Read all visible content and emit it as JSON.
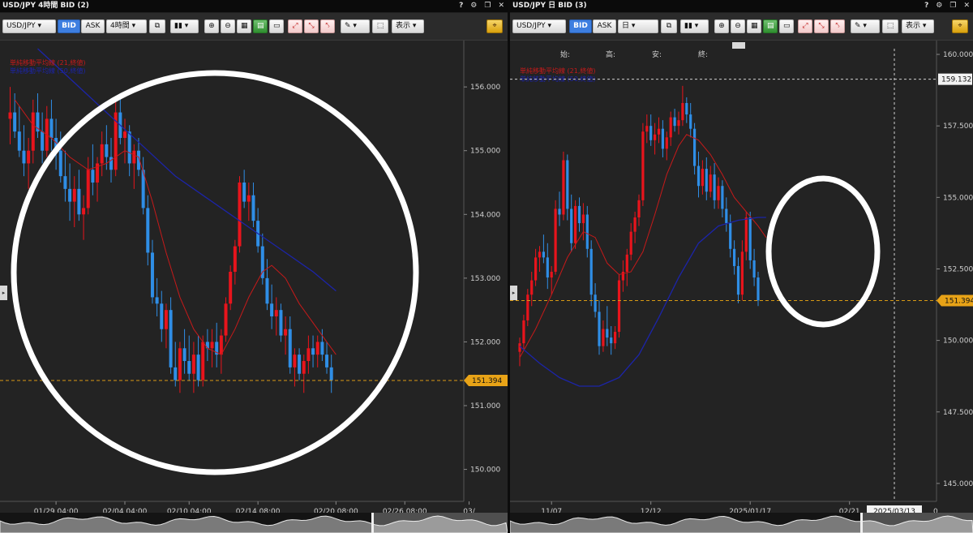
{
  "colors": {
    "up": "#e8141c",
    "down": "#2f8ee6",
    "sma21": "#c61a1a",
    "sma50": "#1c24a8",
    "price_line": "#d89a14",
    "price_label_bg": "#e8a317",
    "grid": "#3a3a3a",
    "axis_text": "#cfcfcf"
  },
  "icons": {
    "help": "question-icon",
    "settings": "gear-icon",
    "restore": "window-restore-icon",
    "close": "close-icon"
  },
  "left": {
    "title": "USD/JPY 4時間 BID (2)",
    "symbol": "USD/JPY",
    "bid_label": "BID",
    "ask_label": "ASK",
    "timeframe": "4時間",
    "display_label": "表示",
    "current_price_label": "151.394",
    "legend": [
      "単純移動平均線 (21,終値)",
      "単純移動平均線 (50,終値)"
    ]
  },
  "right": {
    "title": "USD/JPY 日 BID (3)",
    "symbol": "USD/JPY",
    "bid_label": "BID",
    "ask_label": "ASK",
    "timeframe": "日",
    "display_label": "表示",
    "ohlc_labels": [
      "始:",
      "高:",
      "安:",
      "終:"
    ],
    "current_price_label": "151.394",
    "crosshair_price_label": "159.132",
    "crosshair_date_label": "2025/03/13",
    "nav_zero": "0",
    "legend": [
      "単純移動平均線 (21,終値)",
      "単純移動平均線 (50,終値)"
    ]
  },
  "chart_data": [
    {
      "type": "candlestick",
      "pair": "USD/JPY",
      "timeframe": "4H",
      "ylim": [
        149.6,
        156.6
      ],
      "yticks": [
        150.0,
        151.0,
        152.0,
        153.0,
        154.0,
        155.0,
        156.0
      ],
      "ytick_labels": [
        "150.000",
        "151.000",
        "152.000",
        "153.000",
        "154.000",
        "155.000",
        "156.000"
      ],
      "xticks": [
        {
          "label": "01/29 04:00",
          "index": 10
        },
        {
          "label": "02/04 04:00",
          "index": 25
        },
        {
          "label": "02/10 04:00",
          "index": 39
        },
        {
          "label": "02/14 08:00",
          "index": 54
        },
        {
          "label": "02/20 08:00",
          "index": 71
        },
        {
          "label": "02/26 08:00",
          "index": 86
        },
        {
          "label": "03/",
          "index": 100
        }
      ],
      "current_price": 151.394,
      "ohlc": [
        [
          155.5,
          156.0,
          155.1,
          155.6
        ],
        [
          155.6,
          155.9,
          155.2,
          155.3
        ],
        [
          155.3,
          155.7,
          154.9,
          155.0
        ],
        [
          155.0,
          155.4,
          154.6,
          154.8
        ],
        [
          154.8,
          155.2,
          154.4,
          155.0
        ],
        [
          155.0,
          155.8,
          154.8,
          155.6
        ],
        [
          155.6,
          155.9,
          155.2,
          155.3
        ],
        [
          155.3,
          155.6,
          154.8,
          155.0
        ],
        [
          155.0,
          155.7,
          154.9,
          155.5
        ],
        [
          155.5,
          155.8,
          155.0,
          155.2
        ],
        [
          155.2,
          155.5,
          154.7,
          155.0
        ],
        [
          155.0,
          155.3,
          154.5,
          154.6
        ],
        [
          154.6,
          155.0,
          154.2,
          154.4
        ],
        [
          154.4,
          154.8,
          153.9,
          154.2
        ],
        [
          154.2,
          154.6,
          153.8,
          154.4
        ],
        [
          154.4,
          154.7,
          153.9,
          154.0
        ],
        [
          154.0,
          154.3,
          153.6,
          154.1
        ],
        [
          154.1,
          154.9,
          154.0,
          154.7
        ],
        [
          154.7,
          155.1,
          154.3,
          154.5
        ],
        [
          154.5,
          154.9,
          154.2,
          154.8
        ],
        [
          154.8,
          155.3,
          154.6,
          155.1
        ],
        [
          155.1,
          155.4,
          154.7,
          154.9
        ],
        [
          154.9,
          155.2,
          154.5,
          154.7
        ],
        [
          154.7,
          155.8,
          154.6,
          155.6
        ],
        [
          155.6,
          155.9,
          155.1,
          155.2
        ],
        [
          155.2,
          155.5,
          154.8,
          155.3
        ],
        [
          155.3,
          155.4,
          154.6,
          154.8
        ],
        [
          154.8,
          155.1,
          154.4,
          155.0
        ],
        [
          155.0,
          155.2,
          154.6,
          154.7
        ],
        [
          154.7,
          154.9,
          154.0,
          154.1
        ],
        [
          154.1,
          154.3,
          153.2,
          153.4
        ],
        [
          153.4,
          153.6,
          152.6,
          152.7
        ],
        [
          152.7,
          153.0,
          152.4,
          152.6
        ],
        [
          152.6,
          152.8,
          152.0,
          152.2
        ],
        [
          152.2,
          152.6,
          151.9,
          152.5
        ],
        [
          152.5,
          152.7,
          151.5,
          151.6
        ],
        [
          151.6,
          152.0,
          151.3,
          151.4
        ],
        [
          151.4,
          152.0,
          151.2,
          151.9
        ],
        [
          151.9,
          152.2,
          151.5,
          151.7
        ],
        [
          151.7,
          152.1,
          151.4,
          151.5
        ],
        [
          151.5,
          152.0,
          151.2,
          151.8
        ],
        [
          151.8,
          152.1,
          151.3,
          151.4
        ],
        [
          151.4,
          152.1,
          151.3,
          152.0
        ],
        [
          152.0,
          152.2,
          151.7,
          151.9
        ],
        [
          151.9,
          152.2,
          151.6,
          152.0
        ],
        [
          152.0,
          152.3,
          151.6,
          151.8
        ],
        [
          151.8,
          152.2,
          151.5,
          152.1
        ],
        [
          152.1,
          152.7,
          152.0,
          152.6
        ],
        [
          152.6,
          153.2,
          152.5,
          153.1
        ],
        [
          153.1,
          153.6,
          152.9,
          153.5
        ],
        [
          153.5,
          154.6,
          153.4,
          154.5
        ],
        [
          154.5,
          154.7,
          154.1,
          154.2
        ],
        [
          154.2,
          154.5,
          153.9,
          154.3
        ],
        [
          154.3,
          154.5,
          153.8,
          153.9
        ],
        [
          153.9,
          154.1,
          153.4,
          153.5
        ],
        [
          153.5,
          153.7,
          152.9,
          153.0
        ],
        [
          153.0,
          153.3,
          152.5,
          152.6
        ],
        [
          152.6,
          152.9,
          152.2,
          152.4
        ],
        [
          152.4,
          152.7,
          152.1,
          152.5
        ],
        [
          152.5,
          152.6,
          152.0,
          152.1
        ],
        [
          152.1,
          152.4,
          151.8,
          152.2
        ],
        [
          152.2,
          152.4,
          151.5,
          151.6
        ],
        [
          151.6,
          151.9,
          151.3,
          151.8
        ],
        [
          151.8,
          151.9,
          151.4,
          151.5
        ],
        [
          151.5,
          151.8,
          151.2,
          151.7
        ],
        [
          151.7,
          152.1,
          151.5,
          151.9
        ],
        [
          151.9,
          152.1,
          151.6,
          151.8
        ],
        [
          151.8,
          152.1,
          151.6,
          152.0
        ],
        [
          152.0,
          152.2,
          151.7,
          151.8
        ],
        [
          151.8,
          152.0,
          151.5,
          151.6
        ],
        [
          151.6,
          151.8,
          151.2,
          151.4
        ]
      ],
      "sma21": [
        [
          1,
          155.8
        ],
        [
          5,
          155.4
        ],
        [
          9,
          155.2
        ],
        [
          13,
          154.9
        ],
        [
          17,
          154.7
        ],
        [
          21,
          154.8
        ],
        [
          25,
          155.0
        ],
        [
          28,
          154.9
        ],
        [
          31,
          154.2
        ],
        [
          34,
          153.4
        ],
        [
          37,
          152.7
        ],
        [
          40,
          152.2
        ],
        [
          43,
          151.9
        ],
        [
          46,
          151.8
        ],
        [
          49,
          152.2
        ],
        [
          52,
          152.7
        ],
        [
          55,
          153.1
        ],
        [
          57,
          153.2
        ],
        [
          60,
          153.0
        ],
        [
          63,
          152.6
        ],
        [
          66,
          152.3
        ],
        [
          69,
          152.0
        ],
        [
          71,
          151.8
        ]
      ],
      "sma50": [
        [
          6,
          156.6
        ],
        [
          12,
          156.2
        ],
        [
          18,
          155.8
        ],
        [
          24,
          155.4
        ],
        [
          30,
          155.0
        ],
        [
          36,
          154.6
        ],
        [
          42,
          154.3
        ],
        [
          48,
          154.0
        ],
        [
          54,
          153.7
        ],
        [
          60,
          153.4
        ],
        [
          66,
          153.1
        ],
        [
          71,
          152.8
        ]
      ]
    },
    {
      "type": "candlestick",
      "pair": "USD/JPY",
      "timeframe": "D",
      "ylim": [
        144.6,
        160.2
      ],
      "yticks": [
        145.0,
        147.5,
        150.0,
        152.5,
        155.0,
        157.5,
        160.0
      ],
      "ytick_labels": [
        "145.000",
        "147.500",
        "150.000",
        "152.500",
        "155.000",
        "157.500",
        "160.000"
      ],
      "xticks": [
        {
          "label": "11/07",
          "index": 8
        },
        {
          "label": "12/12",
          "index": 33
        },
        {
          "label": "2025/01/17",
          "index": 58
        },
        {
          "label": "02/21",
          "index": 83
        }
      ],
      "current_price": 151.394,
      "crosshair_price": 159.132,
      "crosshair_date": "2025/03/13",
      "ohlc": [
        [
          149.6,
          150.1,
          149.1,
          149.9
        ],
        [
          149.9,
          150.9,
          149.7,
          150.7
        ],
        [
          150.7,
          151.8,
          150.5,
          151.6
        ],
        [
          151.6,
          152.4,
          151.2,
          152.1
        ],
        [
          152.1,
          153.2,
          151.9,
          152.9
        ],
        [
          152.9,
          153.3,
          152.4,
          153.1
        ],
        [
          153.1,
          153.7,
          152.7,
          152.9
        ],
        [
          152.9,
          153.4,
          151.8,
          152.2
        ],
        [
          152.2,
          152.6,
          151.6,
          152.4
        ],
        [
          152.4,
          154.9,
          152.3,
          154.6
        ],
        [
          154.6,
          155.2,
          154.0,
          154.4
        ],
        [
          154.4,
          156.6,
          154.2,
          156.3
        ],
        [
          156.3,
          156.5,
          154.2,
          154.6
        ],
        [
          154.6,
          155.1,
          153.1,
          153.4
        ],
        [
          153.4,
          154.9,
          153.2,
          154.7
        ],
        [
          154.7,
          155.0,
          153.8,
          154.1
        ],
        [
          154.1,
          154.8,
          153.5,
          154.4
        ],
        [
          154.4,
          154.7,
          152.9,
          153.2
        ],
        [
          153.2,
          153.5,
          151.2,
          151.6
        ],
        [
          151.6,
          152.0,
          150.8,
          151.0
        ],
        [
          151.0,
          151.4,
          149.5,
          149.8
        ],
        [
          149.8,
          150.7,
          149.6,
          150.4
        ],
        [
          150.4,
          151.2,
          149.8,
          150.1
        ],
        [
          150.1,
          150.5,
          149.5,
          149.9
        ],
        [
          149.9,
          150.5,
          149.7,
          150.3
        ],
        [
          150.3,
          152.3,
          150.1,
          152.1
        ],
        [
          152.1,
          152.8,
          151.7,
          152.4
        ],
        [
          152.4,
          153.2,
          151.9,
          153.0
        ],
        [
          153.0,
          154.1,
          152.8,
          153.8
        ],
        [
          153.8,
          154.5,
          153.4,
          154.3
        ],
        [
          154.3,
          155.1,
          154.0,
          154.9
        ],
        [
          154.9,
          157.6,
          154.7,
          157.3
        ],
        [
          157.3,
          157.9,
          156.9,
          157.5
        ],
        [
          157.5,
          157.9,
          156.8,
          157.0
        ],
        [
          157.0,
          157.6,
          156.5,
          157.2
        ],
        [
          157.2,
          157.8,
          156.9,
          157.4
        ],
        [
          157.4,
          157.7,
          156.4,
          156.7
        ],
        [
          156.7,
          157.3,
          156.3,
          157.1
        ],
        [
          157.1,
          158.0,
          156.8,
          157.8
        ],
        [
          157.8,
          158.1,
          157.3,
          157.5
        ],
        [
          157.5,
          158.0,
          157.2,
          157.7
        ],
        [
          157.7,
          158.9,
          157.5,
          158.3
        ],
        [
          158.3,
          158.5,
          157.6,
          157.9
        ],
        [
          157.9,
          158.3,
          157.1,
          157.4
        ],
        [
          157.4,
          157.6,
          155.8,
          156.1
        ],
        [
          156.1,
          156.6,
          155.0,
          155.4
        ],
        [
          155.4,
          156.3,
          155.1,
          156.0
        ],
        [
          156.0,
          156.4,
          154.9,
          155.2
        ],
        [
          155.2,
          156.1,
          155.0,
          155.8
        ],
        [
          155.8,
          156.2,
          154.6,
          154.9
        ],
        [
          154.9,
          155.7,
          154.6,
          155.4
        ],
        [
          155.4,
          155.6,
          154.3,
          154.6
        ],
        [
          154.6,
          155.0,
          153.8,
          154.1
        ],
        [
          154.1,
          154.4,
          152.9,
          153.2
        ],
        [
          153.2,
          153.5,
          152.3,
          152.6
        ],
        [
          152.6,
          152.9,
          151.3,
          151.6
        ],
        [
          151.6,
          153.5,
          151.4,
          153.1
        ],
        [
          153.1,
          154.5,
          152.8,
          154.3
        ],
        [
          154.3,
          154.5,
          152.5,
          152.8
        ],
        [
          152.8,
          153.2,
          151.9,
          152.2
        ],
        [
          152.2,
          152.4,
          151.2,
          151.4
        ]
      ],
      "sma21": [
        [
          0,
          149.4
        ],
        [
          4,
          150.4
        ],
        [
          8,
          151.6
        ],
        [
          12,
          152.9
        ],
        [
          16,
          153.8
        ],
        [
          19,
          153.6
        ],
        [
          22,
          152.7
        ],
        [
          25,
          152.3
        ],
        [
          28,
          152.4
        ],
        [
          31,
          153.1
        ],
        [
          34,
          154.4
        ],
        [
          37,
          155.8
        ],
        [
          40,
          156.8
        ],
        [
          42,
          157.2
        ],
        [
          45,
          157.0
        ],
        [
          48,
          156.5
        ],
        [
          51,
          155.8
        ],
        [
          54,
          155.0
        ],
        [
          57,
          154.5
        ],
        [
          60,
          154.0
        ],
        [
          62,
          153.6
        ]
      ],
      "sma50": [
        [
          0,
          149.8
        ],
        [
          5,
          149.2
        ],
        [
          10,
          148.7
        ],
        [
          15,
          148.4
        ],
        [
          20,
          148.4
        ],
        [
          25,
          148.7
        ],
        [
          30,
          149.5
        ],
        [
          35,
          150.8
        ],
        [
          40,
          152.2
        ],
        [
          45,
          153.4
        ],
        [
          50,
          154.0
        ],
        [
          55,
          154.2
        ],
        [
          60,
          154.3
        ],
        [
          62,
          154.3
        ]
      ]
    }
  ]
}
